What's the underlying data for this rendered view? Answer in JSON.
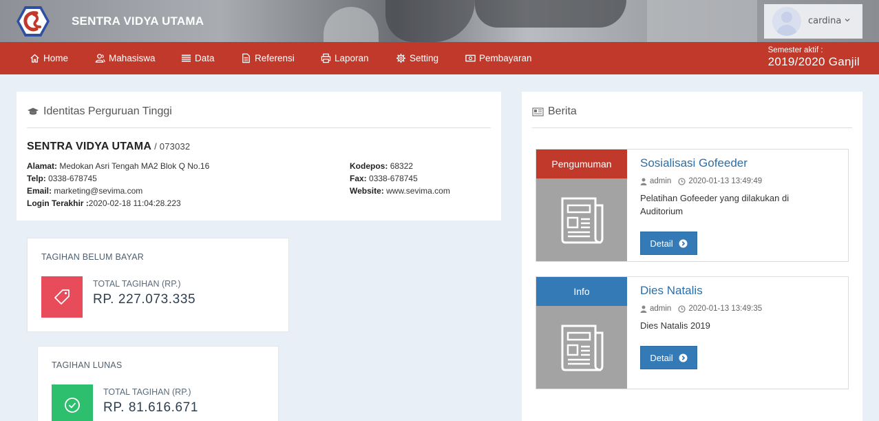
{
  "header": {
    "brand": "SENTRA VIDYA UTAMA",
    "username": "cardina"
  },
  "nav": {
    "items": [
      {
        "label": "Home",
        "icon": "home-icon"
      },
      {
        "label": "Mahasiswa",
        "icon": "users-icon"
      },
      {
        "label": "Data",
        "icon": "list-icon"
      },
      {
        "label": "Referensi",
        "icon": "file-icon"
      },
      {
        "label": "Laporan",
        "icon": "print-icon"
      },
      {
        "label": "Setting",
        "icon": "gear-icon"
      },
      {
        "label": "Pembayaran",
        "icon": "money-icon"
      }
    ],
    "semester_label": "Semester aktif :",
    "semester_value": "2019/2020 Ganjil"
  },
  "identity": {
    "title": "Identitas Perguruan Tinggi",
    "name": "SENTRA VIDYA UTAMA",
    "code": "/ 073032",
    "alamat_label": "Alamat:",
    "alamat": "Medokan Asri Tengah MA2 Blok Q No.16",
    "telp_label": "Telp:",
    "telp": "0338-678745",
    "email_label": "Email:",
    "email": "marketing@sevima.com",
    "login_label": "Login Terakhir :",
    "login": "2020-02-18 11:04:28.223",
    "kodepos_label": "Kodepos:",
    "kodepos": "68322",
    "fax_label": "Fax:",
    "fax": "0338-678745",
    "website_label": "Website:",
    "website": "www.sevima.com"
  },
  "tagihan_belum": {
    "title": "TAGIHAN BELUM BAYAR",
    "sub": "TOTAL TAGIHAN (RP.)",
    "value": "RP. 227.073.335",
    "color": "#e84c5a"
  },
  "tagihan_lunas": {
    "title": "TAGIHAN LUNAS",
    "sub": "TOTAL TAGIHAN (RP.)",
    "value": "RP. 81.616.671",
    "color": "#2ebf6e"
  },
  "berita": {
    "title": "Berita",
    "items": [
      {
        "category": "Pengumuman",
        "category_color": "#c0392b",
        "title": "Sosialisasi Gofeeder",
        "author": "admin",
        "date": "2020-01-13 13:49:49",
        "desc": "Pelatihan Gofeeder yang dilakukan di Auditorium",
        "button": "Detail"
      },
      {
        "category": "Info",
        "category_color": "#337ab7",
        "title": "Dies Natalis",
        "author": "admin",
        "date": "2020-01-13 13:49:35",
        "desc": "Dies Natalis 2019",
        "button": "Detail"
      }
    ]
  }
}
